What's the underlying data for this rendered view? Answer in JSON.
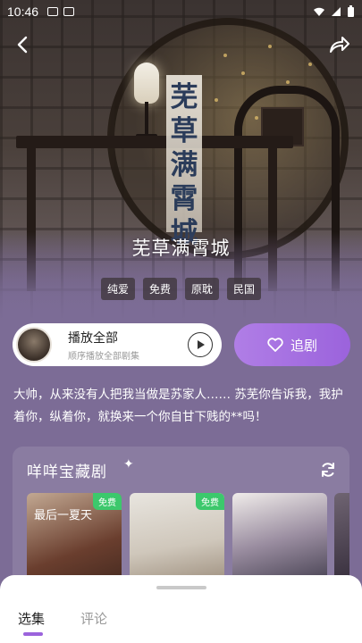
{
  "status_bar": {
    "time": "10:46"
  },
  "hero": {
    "poster_title_chars": [
      "芜",
      "草",
      "满",
      "霄",
      "城"
    ],
    "title": "芜草满霄城",
    "tags": [
      "纯爱",
      "免费",
      "原耽",
      "民国"
    ]
  },
  "actions": {
    "play_all_label": "播放全部",
    "play_all_sub": "顺序播放全部剧集",
    "follow_label": "追剧"
  },
  "description": "大帅，从来没有人把我当做是苏家人…… 苏芜你告诉我，我护着你，纵着你，就换来一个你自甘下贱的**吗！",
  "treasure": {
    "title": "咩咩宝藏剧",
    "posters": [
      {
        "badge": "免费",
        "poster_text": "最后一夏天"
      },
      {
        "badge": "免费"
      },
      {
        "badge": ""
      }
    ]
  },
  "sheet": {
    "tabs": [
      {
        "label": "选集",
        "active": true
      },
      {
        "label": "评论",
        "active": false
      }
    ]
  },
  "colors": {
    "accent": "#9b63dc",
    "free_badge": "#3cc86c",
    "background": "#7c6c96"
  },
  "icons": [
    "back-arrow-icon",
    "share-icon",
    "play-icon",
    "heart-icon",
    "refresh-icon",
    "sparkle-icon"
  ]
}
